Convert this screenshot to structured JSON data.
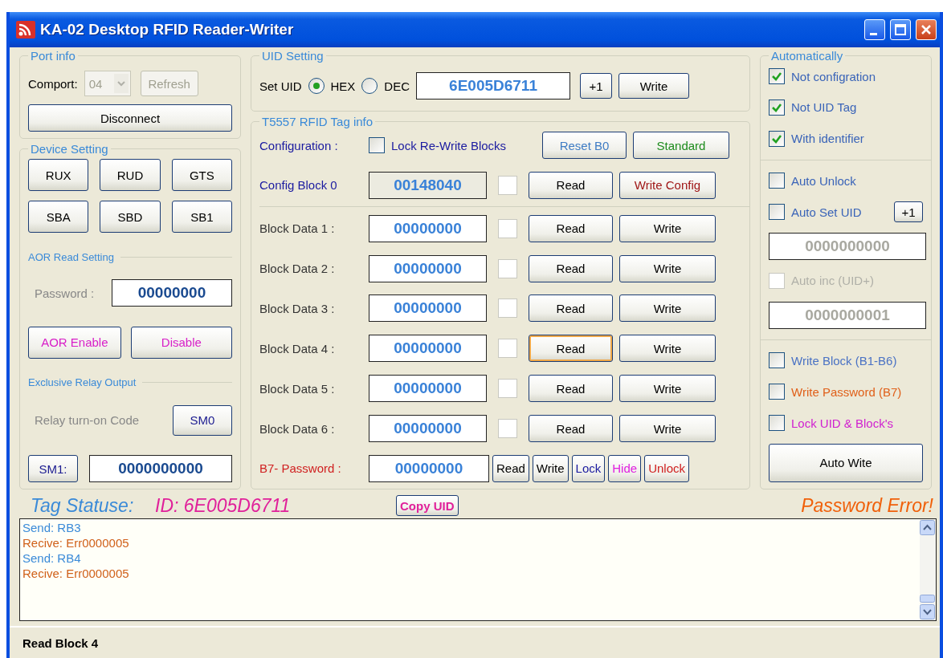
{
  "window": {
    "title": "KA-02 Desktop RFID Reader-Writer"
  },
  "port_info": {
    "title": "Port info",
    "comport_label": "Comport:",
    "comport": {
      "value": "04",
      "disabled": true
    },
    "refresh": {
      "label": "Refresh",
      "disabled": true
    },
    "disconnect": "Disconnect"
  },
  "device_setting": {
    "title": "Device Setting",
    "buttons": [
      "RUX",
      "RUD",
      "GTS",
      "SBA",
      "SBD",
      "SB1"
    ],
    "aor_title": "AOR Read Setting",
    "password_label": "Password :",
    "password_value": "00000000",
    "aor_buttons": [
      {
        "label": "AOR Enable",
        "color": "#d81ec8"
      },
      {
        "label": "Disable",
        "color": "#d81ec8"
      }
    ],
    "relay_title": "Exclusive Relay Output",
    "relay_label": "Relay turn-on Code",
    "sm0": "SM0",
    "sm1": "SM1:",
    "relay_value": "0000000000"
  },
  "uid_setting": {
    "title": "UID Setting",
    "label": "Set UID",
    "radios": [
      {
        "label": "HEX",
        "selected": true
      },
      {
        "label": "DEC",
        "selected": false
      }
    ],
    "value": "6E005D6711",
    "plus": "+1",
    "write": "Write"
  },
  "tag_info": {
    "title": "T5557 RFID Tag info",
    "config_label": "Configuration :",
    "lock": {
      "label": "Lock Re-Write Blocks",
      "checked": false
    },
    "config_buttons": [
      {
        "label": "Reset B0",
        "color": "#3f7cc4"
      },
      {
        "label": "Standard",
        "color": "#1e8c1e"
      }
    ],
    "blocks": [
      {
        "kind": "config",
        "label": "Config Block 0",
        "value": "00148040",
        "checked": false,
        "read": {
          "label": "Read",
          "focused": false
        },
        "write": {
          "label": "Write Config",
          "color": "#a01818"
        }
      },
      {
        "kind": "data",
        "label": "Block Data 1 :",
        "value": "00000000",
        "checked": false,
        "read": {
          "label": "Read",
          "focused": false
        },
        "write": {
          "label": "Write",
          "color": "#000000"
        }
      },
      {
        "kind": "data",
        "label": "Block Data 2 :",
        "value": "00000000",
        "checked": false,
        "read": {
          "label": "Read",
          "focused": false
        },
        "write": {
          "label": "Write",
          "color": "#000000"
        }
      },
      {
        "kind": "data",
        "label": "Block Data 3 :",
        "value": "00000000",
        "checked": false,
        "read": {
          "label": "Read",
          "focused": false
        },
        "write": {
          "label": "Write",
          "color": "#000000"
        }
      },
      {
        "kind": "data",
        "label": "Block Data 4 :",
        "value": "00000000",
        "checked": false,
        "read": {
          "label": "Read",
          "focused": true
        },
        "write": {
          "label": "Write",
          "color": "#000000"
        }
      },
      {
        "kind": "data",
        "label": "Block Data 5 :",
        "value": "00000000",
        "checked": false,
        "read": {
          "label": "Read",
          "focused": false
        },
        "write": {
          "label": "Write",
          "color": "#000000"
        }
      },
      {
        "kind": "data",
        "label": "Block Data 6 :",
        "value": "00000000",
        "checked": false,
        "read": {
          "label": "Read",
          "focused": false
        },
        "write": {
          "label": "Write",
          "color": "#000000"
        }
      }
    ],
    "password": {
      "label": "B7- Password :",
      "value": "00000000",
      "buttons": [
        {
          "label": "Read",
          "color": "#000000"
        },
        {
          "label": "Write",
          "color": "#000000"
        },
        {
          "label": "Lock",
          "color": "#1a1aa0"
        },
        {
          "label": "Hide",
          "color": "#e020e0"
        },
        {
          "label": "Unlock",
          "color": "#d02020"
        }
      ]
    }
  },
  "automatically": {
    "title": "Automatically",
    "sections": [
      [
        {
          "kind": "checkbox",
          "label": "Not configration",
          "checked": true,
          "disabled": false,
          "color": "#3a64b8"
        },
        {
          "kind": "checkbox",
          "label": "Not UID Tag",
          "checked": true,
          "disabled": false,
          "color": "#3a64b8"
        },
        {
          "kind": "checkbox",
          "label": "With identifier",
          "checked": true,
          "disabled": false,
          "color": "#3a64b8"
        }
      ],
      [
        {
          "kind": "checkbox",
          "label": "Auto Unlock",
          "checked": false,
          "disabled": false,
          "color": "#3a64b8"
        },
        {
          "kind": "checkbox",
          "label": "Auto Set UID",
          "checked": false,
          "disabled": false,
          "color": "#3a64b8",
          "button": "+1"
        },
        {
          "kind": "field",
          "value": "0000000000"
        },
        {
          "kind": "checkbox",
          "label": "Auto inc (UID+)",
          "checked": false,
          "disabled": true
        },
        {
          "kind": "field",
          "value": "0000000001"
        }
      ],
      [
        {
          "kind": "checkbox",
          "label": "Write Block (B1-B6)",
          "checked": false,
          "disabled": false,
          "color": "#4a72c4"
        },
        {
          "kind": "checkbox",
          "label": "Write Password (B7)",
          "checked": false,
          "disabled": false,
          "color": "#e0601a"
        },
        {
          "kind": "checkbox",
          "label": "Lock UID & Block's",
          "checked": false,
          "disabled": false,
          "color": "#d020d0"
        }
      ]
    ],
    "button": "Auto Wite"
  },
  "tag_status": {
    "label": "Tag Statuse:",
    "id": "ID: 6E005D6711",
    "copy": "Copy UID",
    "message": "Password Error!"
  },
  "log": [
    {
      "kind": "send",
      "text": "Send: RB3"
    },
    {
      "kind": "receive",
      "text": "Recive: Err0000005"
    },
    {
      "kind": "send",
      "text": "Send: RB4"
    },
    {
      "kind": "receive",
      "text": "Recive: Err0000005"
    }
  ],
  "status_bar": "Read Block 4"
}
